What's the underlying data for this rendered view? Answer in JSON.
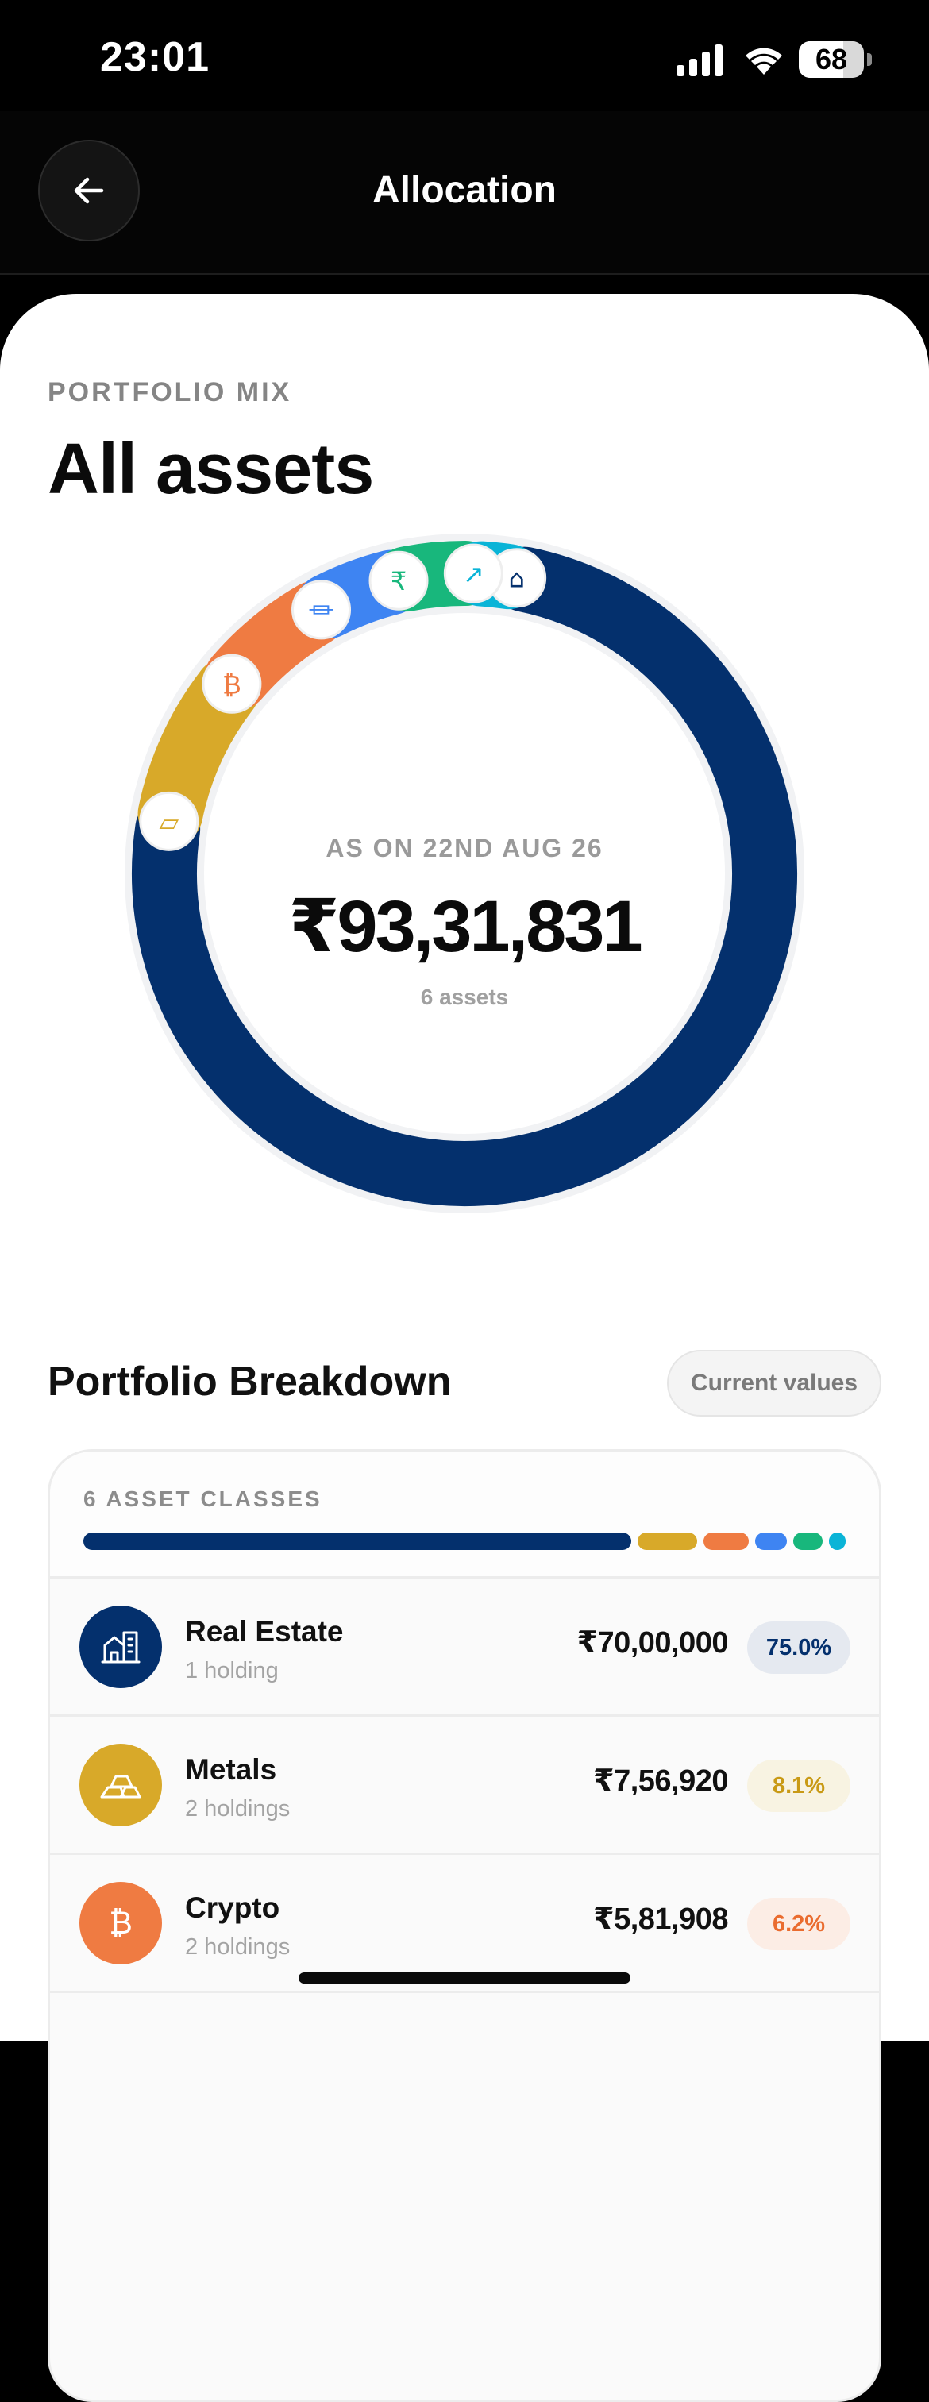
{
  "status_bar": {
    "time": "23:01",
    "battery": "68"
  },
  "header": {
    "title": "Allocation"
  },
  "hero": {
    "eyebrow": "PORTFOLIO MIX",
    "title": "All assets",
    "as_on": "AS ON 22ND AUG 26",
    "total": "₹93,31,831",
    "asset_count": "6 assets"
  },
  "breakdown": {
    "title": "Portfolio Breakdown",
    "toggle_label": "Current values",
    "classes_label": "6 ASSET CLASSES"
  },
  "colors": {
    "real_estate": "#04306d",
    "metals": "#d8a929",
    "crypto": "#ef7b42",
    "bank": "#3e84f2",
    "cash": "#18b77c",
    "stocks": "#0ab4d7"
  },
  "allocation": [
    {
      "key": "real_estate",
      "name": "Real Estate",
      "holdings": "1 holding",
      "value": "₹70,00,000",
      "pct": "75.0%",
      "share": 75.0,
      "icon": "building-icon"
    },
    {
      "key": "metals",
      "name": "Metals",
      "holdings": "2 holdings",
      "value": "₹7,56,920",
      "pct": "8.1%",
      "share": 8.1,
      "icon": "gold-bars-icon"
    },
    {
      "key": "crypto",
      "name": "Crypto",
      "holdings": "2 holdings",
      "value": "₹5,81,908",
      "pct": "6.2%",
      "share": 6.2,
      "icon": "bitcoin-icon"
    },
    {
      "key": "bank",
      "share": 4.4,
      "icon": "bank-icon"
    },
    {
      "key": "cash",
      "share": 4.0,
      "icon": "rupee-icon"
    },
    {
      "key": "stocks",
      "share": 2.3,
      "icon": "chart-icon"
    }
  ]
}
